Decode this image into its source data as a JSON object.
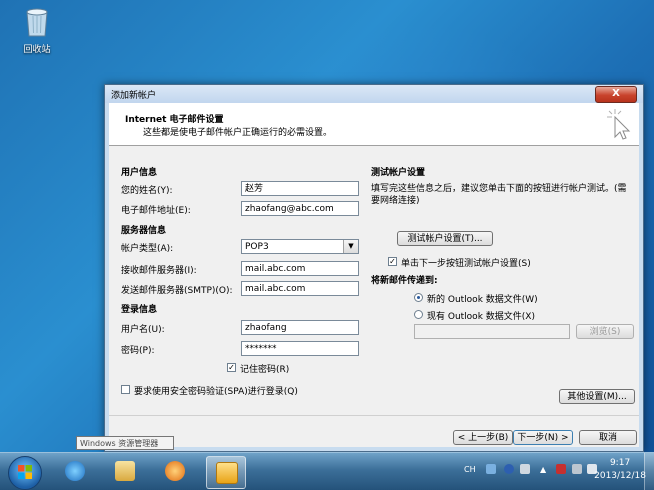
{
  "desktop": {
    "recycle_bin_label": "回收站",
    "tooltip": "Windows 资源管理器"
  },
  "dialog": {
    "title": "添加新帐户",
    "close_label": "X",
    "header_title": "Internet 电子邮件设置",
    "header_subtitle": "这些都是使电子邮件帐户正确运行的必需设置。",
    "user_info": {
      "section": "用户信息",
      "name_label": "您的姓名(Y):",
      "name_value": "赵芳",
      "email_label": "电子邮件地址(E):",
      "email_value": "zhaofang@abc.com"
    },
    "server_info": {
      "section": "服务器信息",
      "account_type_label": "帐户类型(A):",
      "account_type_value": "POP3",
      "incoming_label": "接收邮件服务器(I):",
      "incoming_value": "mail.abc.com",
      "outgoing_label": "发送邮件服务器(SMTP)(O):",
      "outgoing_value": "mail.abc.com"
    },
    "login_info": {
      "section": "登录信息",
      "username_label": "用户名(U):",
      "username_value": "zhaofang",
      "password_label": "密码(P):",
      "password_value": "*******",
      "remember_label": "记住密码(R)",
      "remember_checked": true,
      "spa_label": "要求使用安全密码验证(SPA)进行登录(Q)",
      "spa_checked": false
    },
    "test": {
      "section": "测试帐户设置",
      "description": "填写完这些信息之后，建议您单击下面的按钮进行帐户测试。(需要网络连接)",
      "test_button": "测试帐户设置(T)...",
      "auto_test_label": "单击下一步按钮测试帐户设置(S)",
      "auto_test_checked": true
    },
    "deliver": {
      "section": "将新邮件传递到:",
      "new_file_label": "新的 Outlook 数据文件(W)",
      "existing_file_label": "现有 Outlook 数据文件(X)",
      "selected": "new",
      "browse_button": "浏览(S)"
    },
    "more_settings_button": "其他设置(M)...",
    "back_button": "< 上一步(B)",
    "next_button": "下一步(N) >",
    "cancel_button": "取消"
  },
  "taskbar": {
    "language": "CH",
    "time": "9:17",
    "date": "2013/12/18"
  }
}
